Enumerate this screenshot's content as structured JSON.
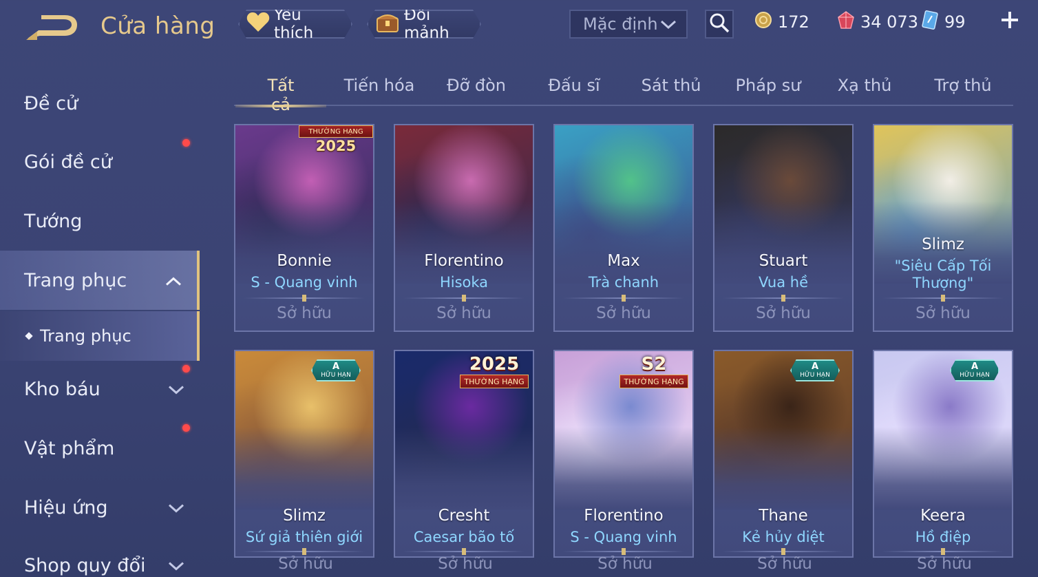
{
  "header": {
    "title": "Cửa hàng",
    "favorites_label": "Yêu thích",
    "shards_label": "Đổi mảnh",
    "sort_value": "Mặc định",
    "currency": {
      "gold": "172",
      "gems": "34 073",
      "vouchers": "99"
    }
  },
  "sidebar": {
    "items": [
      {
        "label": "Đề cử"
      },
      {
        "label": "Gói đề cử"
      },
      {
        "label": "Tướng"
      },
      {
        "label": "Trang phục"
      },
      {
        "label": "Kho báu"
      },
      {
        "label": "Vật phẩm"
      },
      {
        "label": "Hiệu ứng"
      },
      {
        "label": "Shop quy đổi"
      }
    ],
    "sub_item": "Trang phục"
  },
  "tabs": [
    "Tất cả",
    "Tiến hóa",
    "Đỡ đòn",
    "Đấu sĩ",
    "Sát thủ",
    "Pháp sư",
    "Xạ thủ",
    "Trợ thủ"
  ],
  "badges": {
    "limited_top": "A",
    "limited_bottom": "HỮU HẠN",
    "rank_label": "THƯỜNG HẠNG",
    "rank_year": "2025",
    "season": "S2"
  },
  "cards": [
    {
      "hero": "Bonnie",
      "skin": "S - Quang vinh",
      "status": "Sở hữu",
      "colors": [
        "#6a3a8c",
        "#c25fb4",
        "#2f2a55"
      ]
    },
    {
      "hero": "Florentino",
      "skin": "Hisoka",
      "status": "Sở hữu",
      "colors": [
        "#7a2a3a",
        "#c96bb0",
        "#2c2750"
      ]
    },
    {
      "hero": "Max",
      "skin": "Trà chanh",
      "status": "Sở hữu",
      "colors": [
        "#3aa0c4",
        "#52c28a",
        "#3c4f8a"
      ]
    },
    {
      "hero": "Stuart",
      "skin": "Vua hề",
      "status": "Sở hữu",
      "colors": [
        "#2c2a2a",
        "#6a4a3a",
        "#33365a"
      ]
    },
    {
      "hero": "Slimz",
      "skin": "\"Siêu Cấp Tối Thượng\"",
      "status": "Sở hữu",
      "colors": [
        "#e0c45a",
        "#f2eee6",
        "#6aa3c9"
      ]
    },
    {
      "hero": "Slimz",
      "skin": "Sứ giả thiên giới",
      "status": "Sở hữu",
      "colors": [
        "#c98a3a",
        "#e8c06a",
        "#8a5a3a"
      ]
    },
    {
      "hero": "Cresht",
      "skin": "Caesar bão tố",
      "status": "Sở hữu",
      "colors": [
        "#1a2a6a",
        "#6a2aa0",
        "#222a55"
      ]
    },
    {
      "hero": "Florentino",
      "skin": "S - Quang vinh",
      "status": "Sở hữu",
      "colors": [
        "#c8a0d8",
        "#7a8ad0",
        "#f0e6ff"
      ]
    },
    {
      "hero": "Thane",
      "skin": "Kẻ hủy diệt",
      "status": "Sở hữu",
      "colors": [
        "#8a5a2a",
        "#3a2418",
        "#5a3a2a"
      ]
    },
    {
      "hero": "Keera",
      "skin": "Hồ điệp",
      "status": "Sở hữu",
      "colors": [
        "#c8c8f0",
        "#8a7ac8",
        "#e8e0ff"
      ]
    }
  ]
}
